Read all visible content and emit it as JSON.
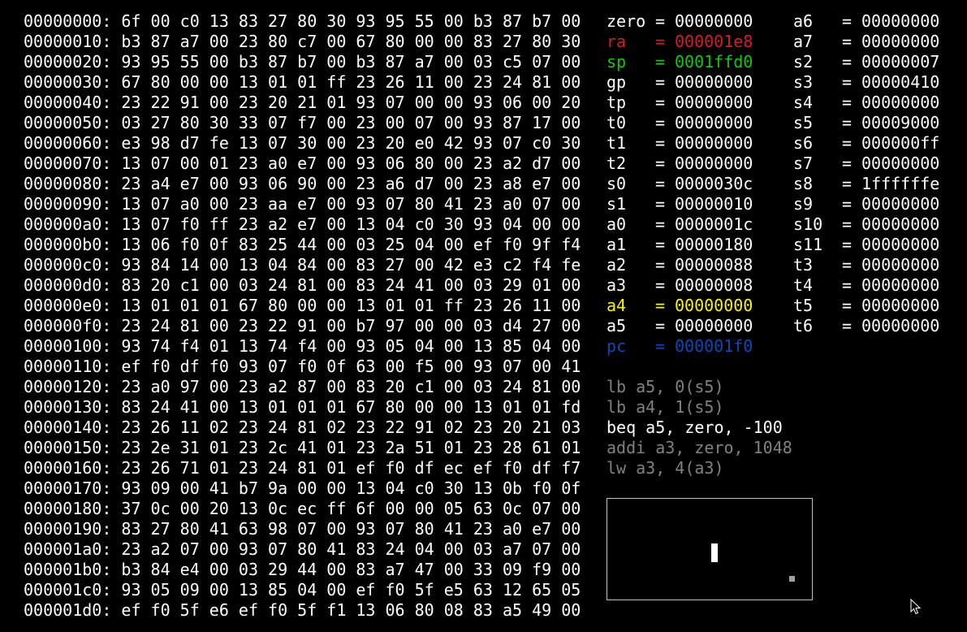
{
  "colors": {
    "background": "#000000",
    "text": "#ffffff",
    "ra": "#d01e2a",
    "sp": "#16c60c",
    "a4": "#f9f11d",
    "pc": "#0f47b8",
    "dim": "#808080"
  },
  "hexdump": [
    "00000000: 6f 00 c0 13 83 27 80 30 93 95 55 00 b3 87 b7 00",
    "00000010: b3 87 a7 00 23 80 c7 00 67 80 00 00 83 27 80 30",
    "00000020: 93 95 55 00 b3 87 b7 00 b3 87 a7 00 03 c5 07 00",
    "00000030: 67 80 00 00 13 01 01 ff 23 26 11 00 23 24 81 00",
    "00000040: 23 22 91 00 23 20 21 01 93 07 00 00 93 06 00 20",
    "00000050: 03 27 80 30 33 07 f7 00 23 00 07 00 93 87 17 00",
    "00000060: e3 98 d7 fe 13 07 30 00 23 20 e0 42 93 07 c0 30",
    "00000070: 13 07 00 01 23 a0 e7 00 93 06 80 00 23 a2 d7 00",
    "00000080: 23 a4 e7 00 93 06 90 00 23 a6 d7 00 23 a8 e7 00",
    "00000090: 13 07 a0 00 23 aa e7 00 93 07 80 41 23 a0 07 00",
    "000000a0: 13 07 f0 ff 23 a2 e7 00 13 04 c0 30 93 04 00 00",
    "000000b0: 13 06 f0 0f 83 25 44 00 03 25 04 00 ef f0 9f f4",
    "000000c0: 93 84 14 00 13 04 84 00 83 27 00 42 e3 c2 f4 fe",
    "000000d0: 83 20 c1 00 03 24 81 00 83 24 41 00 03 29 01 00",
    "000000e0: 13 01 01 01 67 80 00 00 13 01 01 ff 23 26 11 00",
    "000000f0: 23 24 81 00 23 22 91 00 b7 97 00 00 03 d4 27 00",
    "00000100: 93 74 f4 01 13 74 f4 00 93 05 04 00 13 85 04 00",
    "00000110: ef f0 df f0 93 07 f0 0f 63 00 f5 00 93 07 00 41",
    "00000120: 23 a0 97 00 23 a2 87 00 83 20 c1 00 03 24 81 00",
    "00000130: 83 24 41 00 13 01 01 01 67 80 00 00 13 01 01 fd",
    "00000140: 23 26 11 02 23 24 81 02 23 22 91 02 23 20 21 03",
    "00000150: 23 2e 31 01 23 2c 41 01 23 2a 51 01 23 28 61 01",
    "00000160: 23 26 71 01 23 24 81 01 ef f0 df ec ef f0 df f7",
    "00000170: 93 09 00 41 b7 9a 00 00 13 04 c0 30 13 0b f0 0f",
    "00000180: 37 0c 00 20 13 0c ec ff 6f 00 00 05 63 0c 07 00",
    "00000190: 83 27 80 41 63 98 07 00 93 07 80 41 23 a0 e7 00",
    "000001a0: 23 a2 07 00 93 07 80 41 83 24 04 00 03 a7 07 00",
    "000001b0: b3 84 e4 00 03 29 44 00 83 a7 47 00 33 09 f9 00",
    "000001c0: 93 05 09 00 13 85 04 00 ef f0 5f e5 63 12 65 05",
    "000001d0: ef f0 5f e6 ef f0 5f f1 13 06 80 08 83 a5 49 00"
  ],
  "registers_left": [
    {
      "name": "zero",
      "value": "00000000",
      "color": "#ffffff"
    },
    {
      "name": "ra",
      "value": "000001e8",
      "color": "#d01e2a"
    },
    {
      "name": "sp",
      "value": "0001ffd0",
      "color": "#16c60c"
    },
    {
      "name": "gp",
      "value": "00000000",
      "color": "#ffffff"
    },
    {
      "name": "tp",
      "value": "00000000",
      "color": "#ffffff"
    },
    {
      "name": "t0",
      "value": "00000000",
      "color": "#ffffff"
    },
    {
      "name": "t1",
      "value": "00000000",
      "color": "#ffffff"
    },
    {
      "name": "t2",
      "value": "00000000",
      "color": "#ffffff"
    },
    {
      "name": "s0",
      "value": "0000030c",
      "color": "#ffffff"
    },
    {
      "name": "s1",
      "value": "00000010",
      "color": "#ffffff"
    },
    {
      "name": "a0",
      "value": "0000001c",
      "color": "#ffffff"
    },
    {
      "name": "a1",
      "value": "00000180",
      "color": "#ffffff"
    },
    {
      "name": "a2",
      "value": "00000088",
      "color": "#ffffff"
    },
    {
      "name": "a3",
      "value": "00000008",
      "color": "#ffffff"
    },
    {
      "name": "a4",
      "value": "00000000",
      "color": "#f9f11d"
    },
    {
      "name": "a5",
      "value": "00000000",
      "color": "#ffffff"
    },
    {
      "name": "pc",
      "value": "000001f0",
      "color": "#0f47b8"
    }
  ],
  "registers_right": [
    {
      "name": "a6",
      "value": "00000000"
    },
    {
      "name": "a7",
      "value": "00000000"
    },
    {
      "name": "s2",
      "value": "00000007"
    },
    {
      "name": "s3",
      "value": "00000410"
    },
    {
      "name": "s4",
      "value": "00000000"
    },
    {
      "name": "s5",
      "value": "00009000"
    },
    {
      "name": "s6",
      "value": "000000ff"
    },
    {
      "name": "s7",
      "value": "00000000"
    },
    {
      "name": "s8",
      "value": "1ffffffe"
    },
    {
      "name": "s9",
      "value": "00000000"
    },
    {
      "name": "s10",
      "value": "00000000"
    },
    {
      "name": "s11",
      "value": "00000000"
    },
    {
      "name": "t3",
      "value": "00000000"
    },
    {
      "name": "t4",
      "value": "00000000"
    },
    {
      "name": "t5",
      "value": "00000000"
    },
    {
      "name": "t6",
      "value": "00000000"
    }
  ],
  "disassembly": [
    {
      "text": "lb a5, 0(s5)",
      "current": false
    },
    {
      "text": "lb a4, 1(s5)",
      "current": false
    },
    {
      "text": "beq a5, zero, -100",
      "current": true
    },
    {
      "text": "addi a3, zero, 1048",
      "current": false
    },
    {
      "text": "lw a3, 4(a3)",
      "current": false
    }
  ],
  "equals_sign": "=",
  "display_screen": {
    "paddle_color": "#ffffff",
    "ball_color": "#a0a0a0"
  }
}
